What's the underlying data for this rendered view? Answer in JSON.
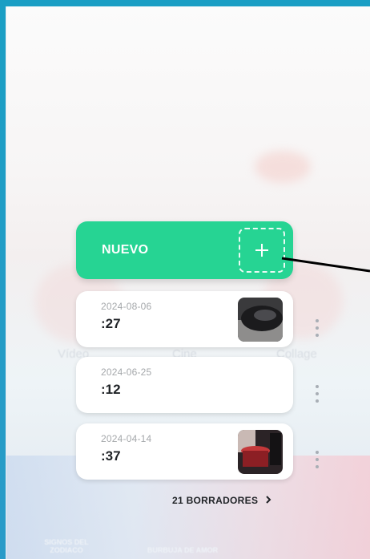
{
  "new_button": {
    "label": "NUEVO",
    "icon": "plus-icon"
  },
  "drafts": [
    {
      "date": "2024-08-06",
      "duration": ":27",
      "has_thumbnail": true
    },
    {
      "date": "2024-06-25",
      "duration": ":12",
      "has_thumbnail": false
    },
    {
      "date": "2024-04-14",
      "duration": ":37",
      "has_thumbnail": true
    }
  ],
  "drafts_link": {
    "label": "21 BORRADORES",
    "icon": "chevron-right-icon"
  },
  "background": {
    "labels": [
      "Vídeo",
      "Cine",
      "Collage"
    ],
    "categories": [
      "SIGNOS DEL ZODIACO",
      "BURBUJA DE AMOR"
    ]
  },
  "colors": {
    "accent": "#26d493",
    "frame": "#1a9ec4",
    "card": "#ffffff",
    "text_primary": "#1f2226",
    "text_secondary": "#a5a8ab"
  }
}
